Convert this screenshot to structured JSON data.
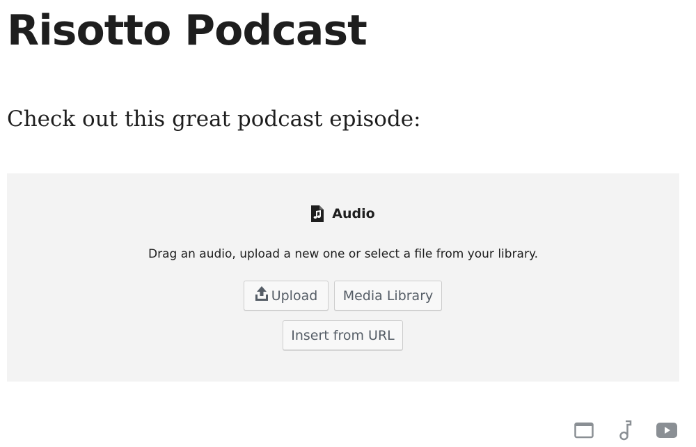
{
  "post": {
    "title": "Risotto Podcast",
    "paragraph": "Check out this great podcast episode:"
  },
  "audio_block": {
    "label": "Audio",
    "label_icon": "audio-file-icon",
    "instructions": "Drag an audio, upload a new one or select a file from your library.",
    "buttons": {
      "upload": "Upload",
      "media_library": "Media Library",
      "insert_url": "Insert from URL"
    },
    "upload_icon": "upload-icon",
    "background": "#f3f3f3"
  },
  "corner_icons": [
    "window-icon",
    "music-note-icon",
    "video-icon"
  ],
  "colors": {
    "text": "#1e1e1e",
    "button_text": "#555d66",
    "icon_gray": "#8a8f94"
  }
}
